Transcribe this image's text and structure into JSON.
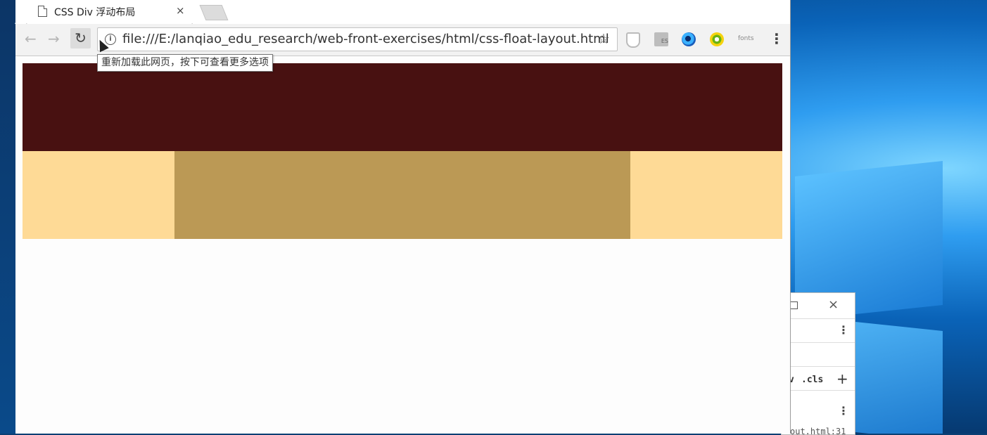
{
  "tab": {
    "title": "CSS Div 浮动布局",
    "close_glyph": "×"
  },
  "toolbar": {
    "back_glyph": "←",
    "forward_glyph": "→",
    "reload_glyph": "↻",
    "info_glyph": "i",
    "url": "file:///E:/lanqiao_edu_research/web-front-exercises/html/css-float-layout.html",
    "star_glyph": "☆",
    "menu_glyph": "⋮"
  },
  "tooltip": {
    "text": "重新加载此网页，按下可查看更多选项"
  },
  "extensions": {
    "fonts_label": "fonts",
    "es_label": "ES"
  },
  "devtools": {
    "close_glyph": "×",
    "kebab_glyph": "⋮",
    "cls_label": ".cls",
    "v_label": "v",
    "plus_glyph": "+",
    "source_partial": "out.html:31"
  },
  "page": {
    "colors": {
      "header": "#481111",
      "side_columns": "#FEDA96",
      "center_column": "#BB9955",
      "background": "#FDFDFD"
    }
  }
}
